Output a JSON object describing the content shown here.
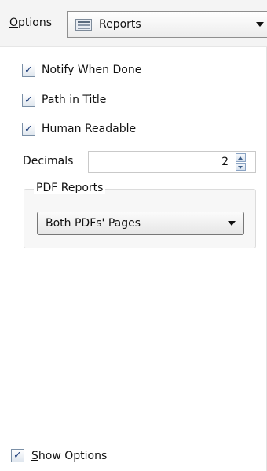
{
  "header": {
    "options_label_first": "O",
    "options_label_rest": "ptions",
    "dropdown": {
      "selected": "Reports",
      "icon": "document-icon"
    }
  },
  "checkboxes": [
    {
      "label": "Notify When Done",
      "checked": true
    },
    {
      "label": "Path in Title",
      "checked": true
    },
    {
      "label": "Human Readable",
      "checked": true
    }
  ],
  "decimals": {
    "label": "Decimals",
    "value": "2"
  },
  "pdf_reports": {
    "legend": "PDF Reports",
    "selected": "Both PDFs' Pages"
  },
  "footer": {
    "show_options_first": "S",
    "show_options_rest": "how Options",
    "checked": true
  },
  "glyphs": {
    "check": "✓"
  },
  "colors": {
    "checkmark": "#1f3e7a",
    "spinner_arrow": "#3a5b86"
  }
}
